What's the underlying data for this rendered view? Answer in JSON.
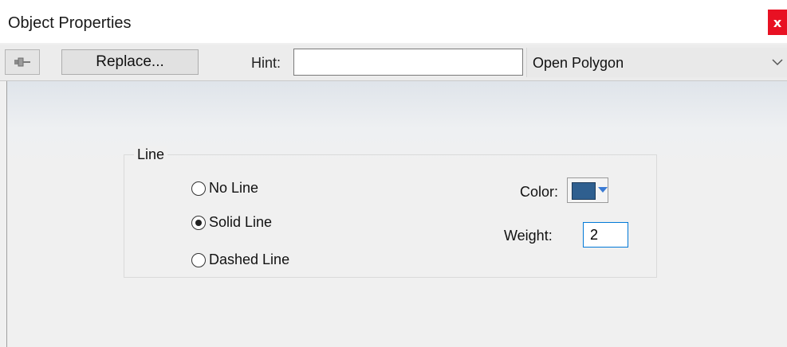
{
  "window": {
    "title": "Object Properties",
    "close_label": "x"
  },
  "toolbar": {
    "pin_icon": "pushpin-icon",
    "replace_label": "Replace...",
    "hint_label": "Hint:",
    "hint_value": "",
    "object_type": "Open Polygon"
  },
  "line_group": {
    "label": "Line",
    "options": [
      {
        "label": "No Line",
        "checked": false
      },
      {
        "label": "Solid Line",
        "checked": true
      },
      {
        "label": "Dashed Line",
        "checked": false
      }
    ],
    "color_label": "Color:",
    "color_value": "#2f5f8f",
    "weight_label": "Weight:",
    "weight_value": "2"
  },
  "colors": {
    "close_button": "#e81123",
    "focus_border": "#0078d7"
  }
}
